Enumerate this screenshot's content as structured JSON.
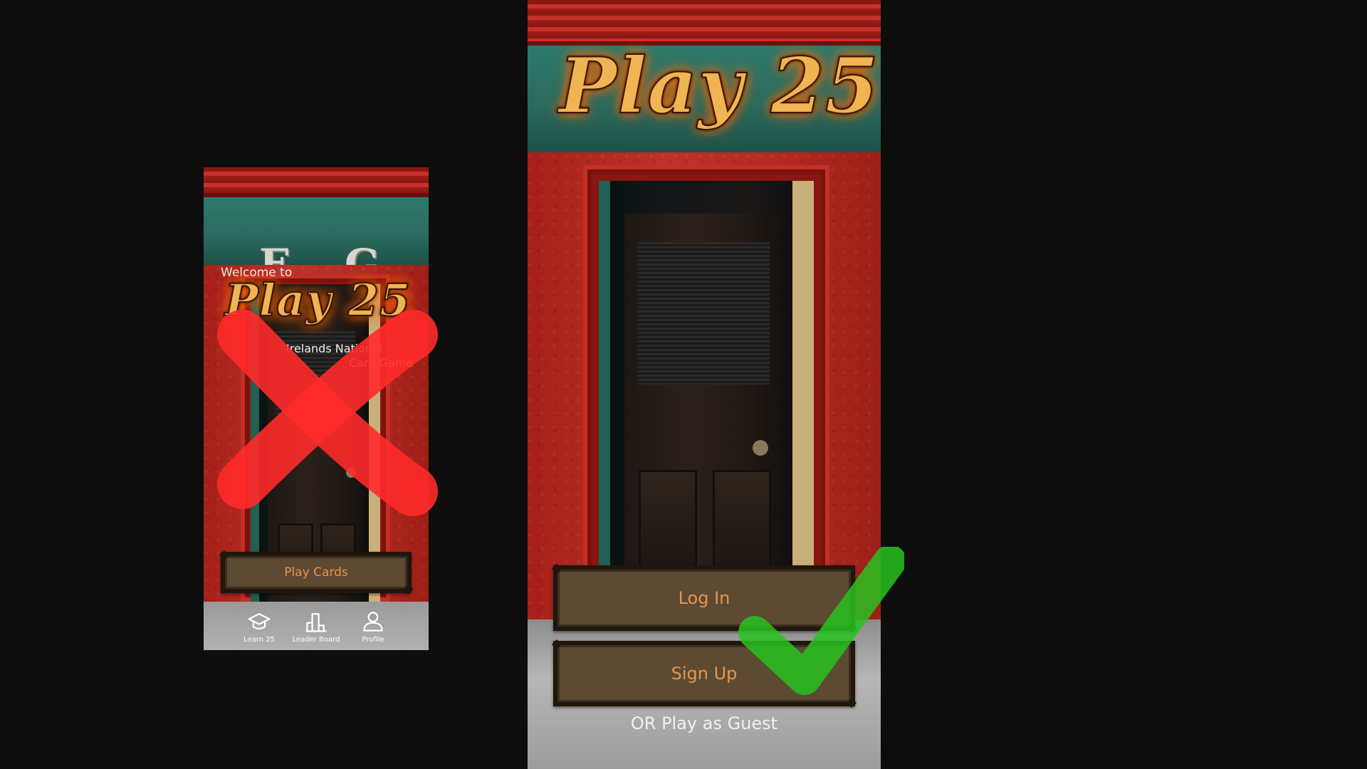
{
  "left_screen": {
    "sign_letters": [
      "E",
      "G"
    ],
    "welcome_text": "Welcome to",
    "logo_text": "Play 25",
    "tagline_line1": "Irelands National",
    "tagline_line2": "Card Game",
    "play_button_label": "Play Cards",
    "nav": [
      {
        "label": "Learn 25",
        "icon": "graduation-cap-icon"
      },
      {
        "label": "Leader Board",
        "icon": "podium-icon"
      },
      {
        "label": "Profile",
        "icon": "user-icon"
      }
    ]
  },
  "right_screen": {
    "logo_text": "Play 25",
    "login_label": "Log In",
    "signup_label": "Sign Up",
    "guest_text": "OR Play as Guest"
  },
  "annotations": {
    "reject_mark": "red-x",
    "approve_mark": "green-check",
    "reject_color": "#ff2a2a",
    "approve_color": "#27c21f"
  },
  "colors": {
    "background": "#0d0d0d",
    "wall_red": "#b3251f",
    "fascia_green": "#2f7a6b",
    "button_wood": "#5c4a33",
    "button_text": "#e8964a",
    "logo_gold": "#f0b452"
  }
}
